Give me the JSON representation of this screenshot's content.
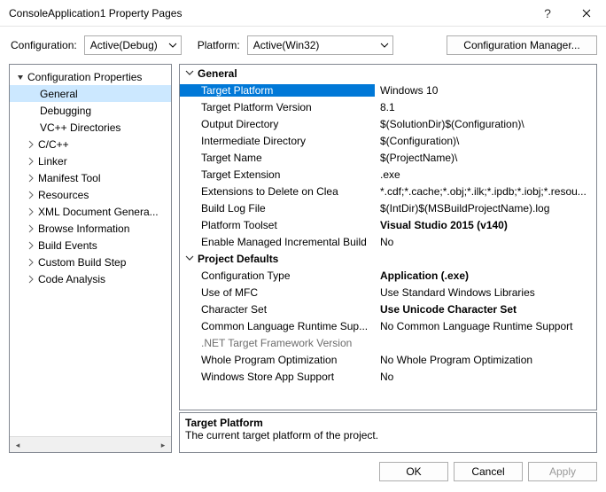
{
  "window": {
    "title": "ConsoleApplication1 Property Pages"
  },
  "topbar": {
    "configuration_label": "Configuration:",
    "configuration_value": "Active(Debug)",
    "platform_label": "Platform:",
    "platform_value": "Active(Win32)",
    "config_manager_label": "Configuration Manager..."
  },
  "tree": {
    "root": {
      "label": "Configuration Properties",
      "expanded": true
    },
    "children": [
      {
        "label": "General",
        "selected": true
      },
      {
        "label": "Debugging"
      },
      {
        "label": "VC++ Directories"
      },
      {
        "label": "C/C++",
        "expandable": true
      },
      {
        "label": "Linker",
        "expandable": true
      },
      {
        "label": "Manifest Tool",
        "expandable": true
      },
      {
        "label": "Resources",
        "expandable": true
      },
      {
        "label": "XML Document Genera...",
        "expandable": true
      },
      {
        "label": "Browse Information",
        "expandable": true
      },
      {
        "label": "Build Events",
        "expandable": true
      },
      {
        "label": "Custom Build Step",
        "expandable": true
      },
      {
        "label": "Code Analysis",
        "expandable": true
      }
    ]
  },
  "grid": {
    "cat1": "General",
    "rows1": [
      {
        "name": "Target Platform",
        "value": "Windows 10",
        "selected": true
      },
      {
        "name": "Target Platform Version",
        "value": "8.1"
      },
      {
        "name": "Output Directory",
        "value": "$(SolutionDir)$(Configuration)\\"
      },
      {
        "name": "Intermediate Directory",
        "value": "$(Configuration)\\"
      },
      {
        "name": "Target Name",
        "value": "$(ProjectName)\\"
      },
      {
        "name": "Target Extension",
        "value": ".exe"
      },
      {
        "name": "Extensions to Delete on Clea",
        "value": "*.cdf;*.cache;*.obj;*.ilk;*.ipdb;*.iobj;*.resou..."
      },
      {
        "name": "Build Log File",
        "value": "$(IntDir)$(MSBuildProjectName).log"
      },
      {
        "name": "Platform Toolset",
        "value": "Visual Studio 2015 (v140)",
        "bold": true
      },
      {
        "name": "Enable Managed Incremental Build",
        "value": "No"
      }
    ],
    "cat2": "Project Defaults",
    "rows2": [
      {
        "name": "Configuration Type",
        "value": "Application (.exe)",
        "bold": true
      },
      {
        "name": "Use of MFC",
        "value": "Use Standard Windows Libraries"
      },
      {
        "name": "Character Set",
        "value": "Use Unicode Character Set",
        "bold": true
      },
      {
        "name": "Common Language Runtime Sup...",
        "value": "No Common Language Runtime Support"
      },
      {
        "name": ".NET Target Framework Version",
        "value": "",
        "disabled": true
      },
      {
        "name": "Whole Program Optimization",
        "value": "No Whole Program Optimization"
      },
      {
        "name": "Windows Store App Support",
        "value": "No"
      }
    ]
  },
  "description": {
    "title": "Target Platform",
    "text": "The current target platform of the project."
  },
  "buttons": {
    "ok": "OK",
    "cancel": "Cancel",
    "apply": "Apply"
  }
}
